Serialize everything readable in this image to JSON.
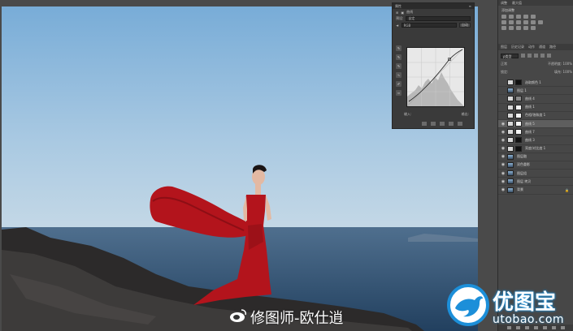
{
  "properties_panel": {
    "title": "属性",
    "subtitle": "曲线",
    "preset_label": "预设:",
    "preset_value": "自定",
    "channel_value": "RGB",
    "auto_button": "自动",
    "input_label": "输入:",
    "output_label": "输出:"
  },
  "dock": {
    "top_tabs": [
      "调整",
      "最大值"
    ],
    "adjust_label": "添加调整",
    "layer_tabs": [
      "图层",
      "历史记录",
      "动作",
      "通道",
      "路径"
    ],
    "filter_kind": "ρ类型",
    "blend_mode": "正常",
    "opacity_label": "不透明度: 100%",
    "lock_label": "锁定:",
    "fill_label": "填充: 100%",
    "layers": [
      {
        "name": "选取颜色 1",
        "visible": false,
        "thumb": "adjust",
        "mask": "dark"
      },
      {
        "name": "图层 1",
        "visible": false,
        "thumb": "photo",
        "mask": ""
      },
      {
        "name": "曲线 4",
        "visible": false,
        "thumb": "adjust",
        "mask": "gray"
      },
      {
        "name": "曲线 1",
        "visible": false,
        "thumb": "adjust",
        "mask": "white"
      },
      {
        "name": "色相/饱和度 1",
        "visible": false,
        "thumb": "adjust",
        "mask": "white"
      },
      {
        "name": "曲线 5",
        "visible": true,
        "thumb": "adjust",
        "mask": "white",
        "active": true
      },
      {
        "name": "曲线 7",
        "visible": true,
        "thumb": "adjust",
        "mask": "white"
      },
      {
        "name": "曲线 3",
        "visible": true,
        "thumb": "adjust",
        "mask": "dark"
      },
      {
        "name": "亮度/对比度 1",
        "visible": true,
        "thumb": "adjust",
        "mask": "dark"
      },
      {
        "name": "图层融",
        "visible": true,
        "thumb": "photo",
        "mask": ""
      },
      {
        "name": "双色重影",
        "visible": true,
        "thumb": "photo",
        "mask": ""
      },
      {
        "name": "图层组",
        "visible": true,
        "thumb": "photo",
        "mask": ""
      },
      {
        "name": "图层 拷贝",
        "visible": true,
        "thumb": "photo",
        "mask": ""
      },
      {
        "name": "背景",
        "visible": true,
        "thumb": "photo",
        "mask": "",
        "locked": true
      }
    ]
  },
  "watermark": {
    "author": "修图师-欧仕逍",
    "logo_main": "优图宝",
    "logo_sub": "utobao.com"
  },
  "colors": {
    "sky_top": "#7aaed8",
    "sea": "#2f4e6e",
    "dress": "#b3141c",
    "logo_blue": "#1c8fd9"
  }
}
